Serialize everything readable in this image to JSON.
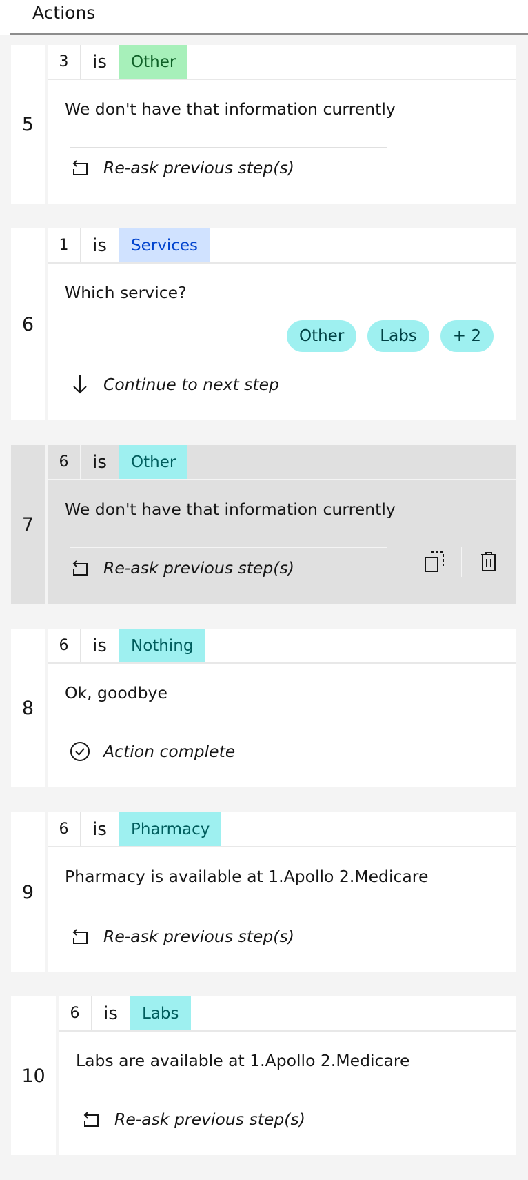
{
  "header": {
    "title": "Actions"
  },
  "steps": [
    {
      "number": "5",
      "cond_step": "3",
      "cond_op": "is",
      "cond_value": "Other",
      "message": "We don't have that information currently",
      "next_action": "Re-ask previous step(s)",
      "next_icon": "reask-icon",
      "tag_color": "green"
    },
    {
      "number": "6",
      "cond_step": "1",
      "cond_op": "is",
      "cond_value": "Services",
      "message": "Which service?",
      "options": [
        "Other",
        "Labs",
        "+ 2"
      ],
      "next_action": "Continue to next step",
      "next_icon": "arrow-down-icon",
      "tag_color": "blue"
    },
    {
      "number": "7",
      "cond_step": "6",
      "cond_op": "is",
      "cond_value": "Other",
      "message": "We don't have that information currently",
      "next_action": "Re-ask previous step(s)",
      "next_icon": "reask-icon",
      "tag_color": "teal",
      "hovered": true,
      "tools": [
        "duplicate-icon",
        "delete-icon"
      ]
    },
    {
      "number": "8",
      "cond_step": "6",
      "cond_op": "is",
      "cond_value": "Nothing",
      "message": "Ok, goodbye",
      "next_action": "Action complete",
      "next_icon": "checkmark-outline-icon",
      "tag_color": "teal"
    },
    {
      "number": "9",
      "cond_step": "6",
      "cond_op": "is",
      "cond_value": "Pharmacy",
      "message": "Pharmacy is available at 1.Apollo 2.Medicare",
      "next_action": "Re-ask previous step(s)",
      "next_icon": "reask-icon",
      "tag_color": "teal"
    },
    {
      "number": "10",
      "cond_step": "6",
      "cond_op": "is",
      "cond_value": "Labs",
      "message": "Labs are available at 1.Apollo 2.Medicare",
      "next_action": "Re-ask previous step(s)",
      "next_icon": "reask-icon",
      "tag_color": "teal"
    }
  ],
  "colors": {
    "green_tag": "#a7f0ba",
    "blue_tag": "#d0e2ff",
    "teal_tag": "#9ef0f0",
    "hover_bg": "#e0e0e0"
  }
}
